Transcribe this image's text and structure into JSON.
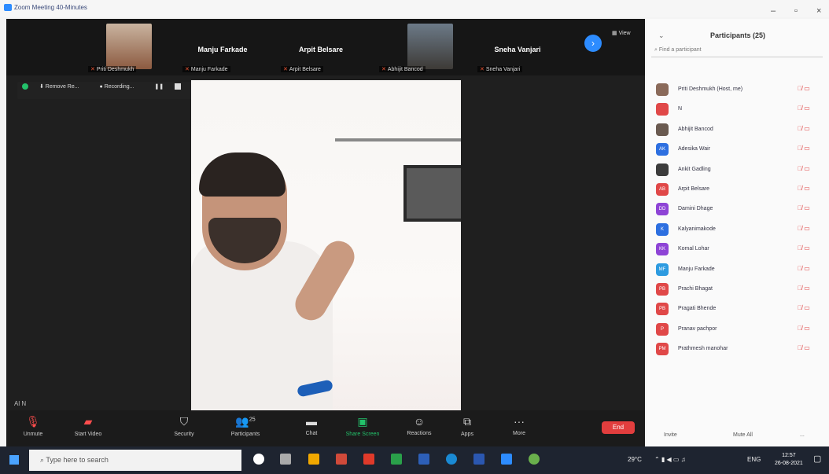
{
  "window": {
    "title": "Zoom Meeting 40-Minutes"
  },
  "top_tiles": [
    {
      "display_name": "",
      "label": "Priti Deshmukh",
      "face": true
    },
    {
      "display_name": "Manju Farkade",
      "label": "Manju Farkade",
      "face": false
    },
    {
      "display_name": "Arpit Belsare",
      "label": "Arpit Belsare",
      "face": false
    },
    {
      "display_name": "",
      "label": "Abhijit Bancod",
      "face": true
    },
    {
      "display_name": "Sneha Vanjari",
      "label": "Sneha Vanjari",
      "face": false
    }
  ],
  "view_label": "View",
  "share_toolbar": {
    "remove": "Remove Re...",
    "recording": "Recording..."
  },
  "alt_text": "Al N",
  "bottombar": {
    "unmute": "Unmute",
    "start_video": "Start Video",
    "security": "Security",
    "participants": "Participants",
    "participants_count": "25",
    "chat": "Chat",
    "share_screen": "Share Screen",
    "reactions": "Reactions",
    "apps": "Apps",
    "more": "More",
    "end": "End"
  },
  "participants_panel": {
    "title": "Participants (25)",
    "search_placeholder": "Find a participant",
    "invite": "Invite",
    "mute_all": "Mute All",
    "more": "...",
    "list": [
      {
        "initials": "",
        "name": "Priti Deshmukh (Host, me)",
        "color": "#8a6a5a"
      },
      {
        "initials": "",
        "name": "N",
        "color": "#e04848"
      },
      {
        "initials": "",
        "name": "Abhijit Bancod",
        "color": "#6a5a50"
      },
      {
        "initials": "AK",
        "name": "Adesika Wair",
        "color": "#2d6fe0"
      },
      {
        "initials": "",
        "name": "Ankit Gadling",
        "color": "#3c3c3c"
      },
      {
        "initials": "AB",
        "name": "Arpit Belsare",
        "color": "#e04848"
      },
      {
        "initials": "DD",
        "name": "Damini Dhage",
        "color": "#8e44d6"
      },
      {
        "initials": "K",
        "name": "Kalyanimakode",
        "color": "#2d6fe0"
      },
      {
        "initials": "KK",
        "name": "Komal Lohar",
        "color": "#8e44d6"
      },
      {
        "initials": "MF",
        "name": "Manju Farkade",
        "color": "#2d9be0"
      },
      {
        "initials": "PB",
        "name": "Prachi Bhagat",
        "color": "#e04848"
      },
      {
        "initials": "PB",
        "name": "Pragati Bhende",
        "color": "#e04848"
      },
      {
        "initials": "P",
        "name": "Pranav pachpor",
        "color": "#e04848"
      },
      {
        "initials": "PM",
        "name": "Prathmesh manohar",
        "color": "#e04848"
      }
    ]
  },
  "taskbar": {
    "search_placeholder": "Type here to search",
    "weather": "29°C",
    "lang": "ENG",
    "time": "12:57",
    "date": "26-08-2021"
  }
}
